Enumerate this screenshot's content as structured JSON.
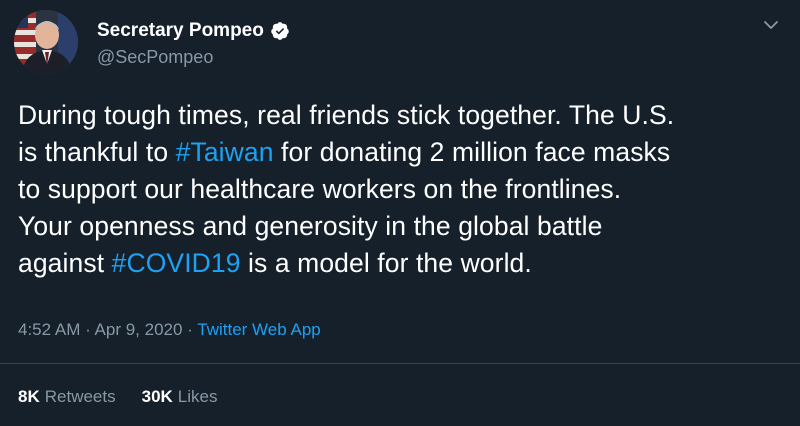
{
  "author": {
    "display_name": "Secretary Pompeo",
    "handle": "@SecPompeo",
    "verified": true,
    "avatar": "portrait-with-flag"
  },
  "tweet": {
    "lines": [
      [
        {
          "text": "During tough times, real friends stick together. The U.S.",
          "type": "text"
        }
      ],
      [
        {
          "text": "is thankful to ",
          "type": "text"
        },
        {
          "text": "#Taiwan",
          "type": "hashtag"
        },
        {
          "text": " for donating 2 million face masks",
          "type": "text"
        }
      ],
      [
        {
          "text": "to support our healthcare workers on the frontlines.",
          "type": "text"
        }
      ],
      [
        {
          "text": "Your openness and generosity in the global battle",
          "type": "text"
        }
      ],
      [
        {
          "text": "against ",
          "type": "text"
        },
        {
          "text": "#COVID19",
          "type": "hashtag"
        },
        {
          "text": " is a model for the world.",
          "type": "text"
        }
      ]
    ]
  },
  "meta": {
    "time": "4:52 AM",
    "separator": " · ",
    "date": "Apr 9, 2020",
    "source": "Twitter Web App"
  },
  "stats": {
    "retweets_count": "8K",
    "retweets_label": "Retweets",
    "likes_count": "30K",
    "likes_label": "Likes"
  },
  "colors": {
    "background": "#15202b",
    "accent": "#1da1f2",
    "secondary_text": "#8899a6",
    "divider": "#38444d"
  },
  "icons": {
    "verified": "verified-badge-icon",
    "caret": "chevron-down-icon"
  }
}
